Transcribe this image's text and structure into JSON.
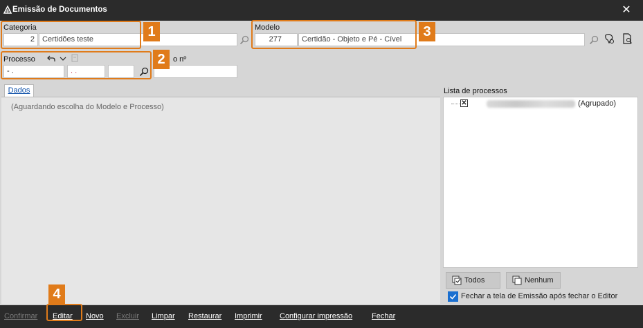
{
  "window": {
    "title": "Emissão de Documentos"
  },
  "categoria": {
    "label": "Categoria",
    "code": "2",
    "name": "Certidões teste"
  },
  "processo": {
    "label": "Processo",
    "part1": " - .",
    "part2": ". .",
    "part3": "",
    "extra_label": "o nº",
    "extra_value": ""
  },
  "modelo": {
    "label": "Modelo",
    "code": "277",
    "name": "Certidão - Objeto e Pé - Cível"
  },
  "callouts": [
    "1",
    "2",
    "3",
    "4"
  ],
  "tabs": {
    "dados": "Dados"
  },
  "dados": {
    "waiting_message": "(Aguardando escolha do Modelo e Processo)"
  },
  "process_list": {
    "label": "Lista de processos",
    "item_suffix": "(Agrupado)",
    "item_checked": true
  },
  "selection": {
    "all": "Todos",
    "none": "Nenhum"
  },
  "close_after": {
    "checked": true,
    "label": "Fechar a tela de Emissão após fechar o Editor"
  },
  "toolbar": {
    "confirmar": "Confirmar",
    "editar": "Editar",
    "novo": "Novo",
    "excluir": "Excluir",
    "limpar": "Limpar",
    "restaurar": "Restaurar",
    "imprimir": "Imprimir",
    "configurar": "Configurar impressão",
    "fechar": "Fechar"
  },
  "colors": {
    "accent": "#e07b1a",
    "titlebar": "#2b2b2b",
    "checkbox": "#1a6fd0"
  }
}
